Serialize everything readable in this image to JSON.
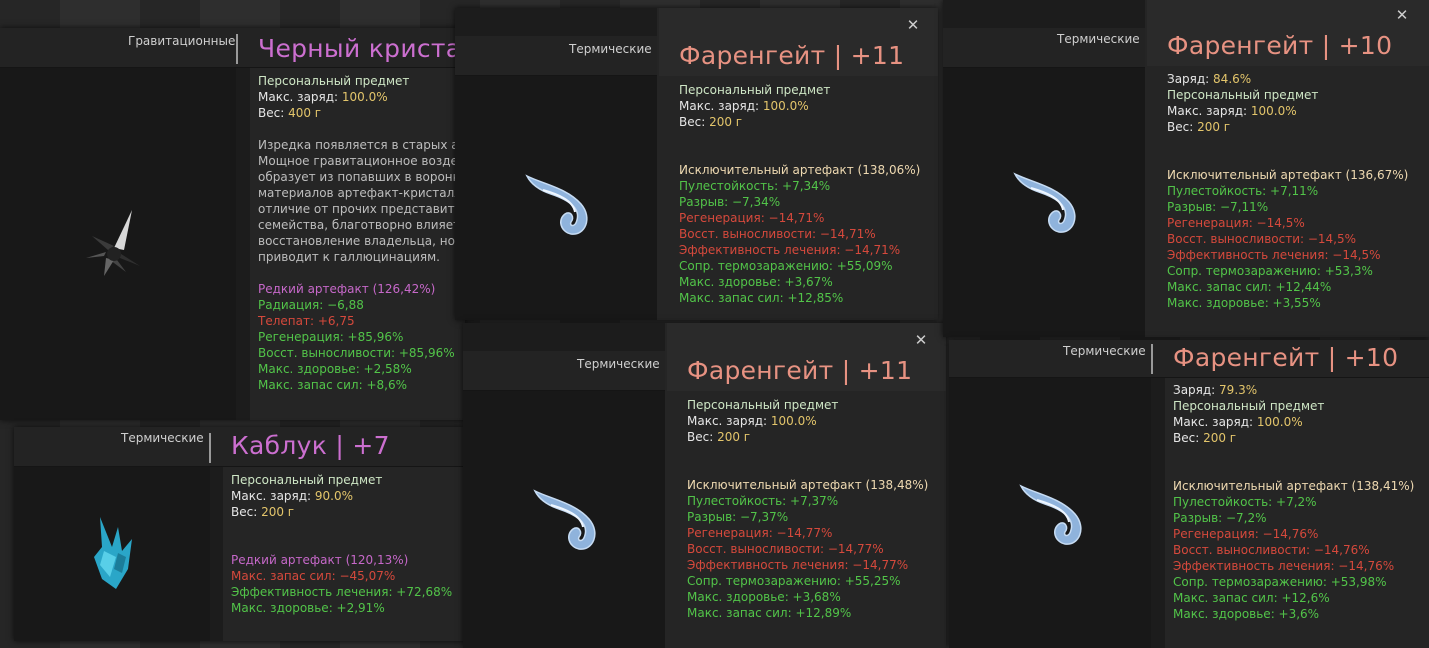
{
  "colors": {
    "title": "#e79282",
    "rare": "#c668c9",
    "positive": "#52c449",
    "negative": "#d5493c"
  },
  "cards": [
    {
      "category": "Гравитационные",
      "title": "Черный кристалл",
      "icon": "black-crystal-icon",
      "lines": [
        {
          "t": "Персональный предмет",
          "c": "personal"
        },
        {
          "t": "Макс. заряд: ",
          "v": "100.0%",
          "c": "stat"
        },
        {
          "t": "Вес: ",
          "v": "400 г",
          "c": "stat"
        }
      ],
      "description": [
        "Изредка появляется в старых ано",
        "Мощное гравитационное воздей",
        "образует из попавших в воронку",
        "материалов артефакт-кристалл, к",
        "отличие от прочих представителе",
        "семейства, благотворно влияет на",
        "восстановление владельца, но ча",
        "приводит к галлюцинациям."
      ],
      "rarity": "Редкий артефакт (126,42%)",
      "stats": [
        {
          "t": "Радиация: −6,88",
          "c": "green"
        },
        {
          "t": "Телепат: +6,75",
          "c": "red"
        },
        {
          "t": "Регенерация: +85,96%",
          "c": "green"
        },
        {
          "t": "Восст. выносливости: +85,96%",
          "c": "green"
        },
        {
          "t": "Макс. здоровье: +2,58%",
          "c": "green"
        },
        {
          "t": "Макс. запас сил: +8,6%",
          "c": "green"
        }
      ]
    },
    {
      "category": "Термические",
      "title": "Каблук | +7",
      "icon": "heel-crystal-icon",
      "lines": [
        {
          "t": "Персональный предмет",
          "c": "personal"
        },
        {
          "t": "Макс. заряд: ",
          "v": "90.0%",
          "c": "stat"
        },
        {
          "t": "Вес: ",
          "v": "200 г",
          "c": "stat"
        }
      ],
      "rarity": "Редкий артефакт (120,13%)",
      "stats": [
        {
          "t": "Макс. запас сил: −45,07%",
          "c": "red"
        },
        {
          "t": "Эффективность лечения: +72,68%",
          "c": "green"
        },
        {
          "t": "Макс. здоровье: +2,91%",
          "c": "green"
        }
      ]
    },
    {
      "category": "Термические",
      "title": "Фаренгейт | +11",
      "icon": "fahrenheit-hook-icon",
      "lines": [
        {
          "t": "Персональный предмет",
          "c": "personal"
        },
        {
          "t": "Макс. заряд: ",
          "v": "100.0%",
          "c": "stat"
        },
        {
          "t": "Вес: ",
          "v": "200 г",
          "c": "stat"
        }
      ],
      "rarity": "Исключительный артефакт (138,06%)",
      "stats": [
        {
          "t": "Пулестойкость: +7,34%",
          "c": "green"
        },
        {
          "t": "Разрыв: −7,34%",
          "c": "green"
        },
        {
          "t": "Регенерация: −14,71%",
          "c": "red"
        },
        {
          "t": "Восст. выносливости: −14,71%",
          "c": "red"
        },
        {
          "t": "Эффективность лечения: −14,71%",
          "c": "red"
        },
        {
          "t": "Сопр. термозаражению: +55,09%",
          "c": "green"
        },
        {
          "t": "Макс. здоровье: +3,67%",
          "c": "green"
        },
        {
          "t": "Макс. запас сил: +12,85%",
          "c": "green"
        }
      ]
    },
    {
      "category": "Термические",
      "title": "Фаренгейт | +11",
      "icon": "fahrenheit-hook-icon",
      "lines": [
        {
          "t": "Персональный предмет",
          "c": "personal"
        },
        {
          "t": "Макс. заряд: ",
          "v": "100.0%",
          "c": "stat"
        },
        {
          "t": "Вес: ",
          "v": "200 г",
          "c": "stat"
        }
      ],
      "rarity": "Исключительный артефакт (138,48%)",
      "stats": [
        {
          "t": "Пулестойкость: +7,37%",
          "c": "green"
        },
        {
          "t": "Разрыв: −7,37%",
          "c": "green"
        },
        {
          "t": "Регенерация: −14,77%",
          "c": "red"
        },
        {
          "t": "Восст. выносливости: −14,77%",
          "c": "red"
        },
        {
          "t": "Эффективность лечения: −14,77%",
          "c": "red"
        },
        {
          "t": "Сопр. термозаражению: +55,25%",
          "c": "green"
        },
        {
          "t": "Макс. здоровье: +3,68%",
          "c": "green"
        },
        {
          "t": "Макс. запас сил: +12,89%",
          "c": "green"
        }
      ]
    },
    {
      "category": "Термические",
      "title": "Фаренгейт | +10",
      "icon": "fahrenheit-hook-icon",
      "lines": [
        {
          "t": "Заряд: ",
          "v": "84.6%",
          "c": "stat"
        },
        {
          "t": "Персональный предмет",
          "c": "personal"
        },
        {
          "t": "Макс. заряд: ",
          "v": "100.0%",
          "c": "stat"
        },
        {
          "t": "Вес: ",
          "v": "200 г",
          "c": "stat"
        }
      ],
      "rarity": "Исключительный артефакт (136,67%)",
      "stats": [
        {
          "t": "Пулестойкость: +7,11%",
          "c": "green"
        },
        {
          "t": "Разрыв: −7,11%",
          "c": "green"
        },
        {
          "t": "Регенерация: −14,5%",
          "c": "red"
        },
        {
          "t": "Восст. выносливости: −14,5%",
          "c": "red"
        },
        {
          "t": "Эффективность лечения: −14,5%",
          "c": "red"
        },
        {
          "t": "Сопр. термозаражению: +53,3%",
          "c": "green"
        },
        {
          "t": "Макс. запас сил: +12,44%",
          "c": "green"
        },
        {
          "t": "Макс. здоровье: +3,55%",
          "c": "green"
        }
      ]
    },
    {
      "category": "Термические",
      "title": "Фаренгейт | +10",
      "icon": "fahrenheit-hook-icon",
      "lines": [
        {
          "t": "Заряд: ",
          "v": "79.3%",
          "c": "stat"
        },
        {
          "t": "Персональный предмет",
          "c": "personal"
        },
        {
          "t": "Макс. заряд: ",
          "v": "100.0%",
          "c": "stat"
        },
        {
          "t": "Вес: ",
          "v": "200 г",
          "c": "stat"
        }
      ],
      "rarity": "Исключительный артефакт (138,41%)",
      "stats": [
        {
          "t": "Пулестойкость: +7,2%",
          "c": "green"
        },
        {
          "t": "Разрыв: −7,2%",
          "c": "green"
        },
        {
          "t": "Регенерация: −14,76%",
          "c": "red"
        },
        {
          "t": "Восст. выносливости: −14,76%",
          "c": "red"
        },
        {
          "t": "Эффективность лечения: −14,76%",
          "c": "red"
        },
        {
          "t": "Сопр. термозаражению: +53,98%",
          "c": "green"
        },
        {
          "t": "Макс. запас сил: +12,6%",
          "c": "green"
        },
        {
          "t": "Макс. здоровье: +3,6%",
          "c": "green"
        }
      ]
    }
  ]
}
